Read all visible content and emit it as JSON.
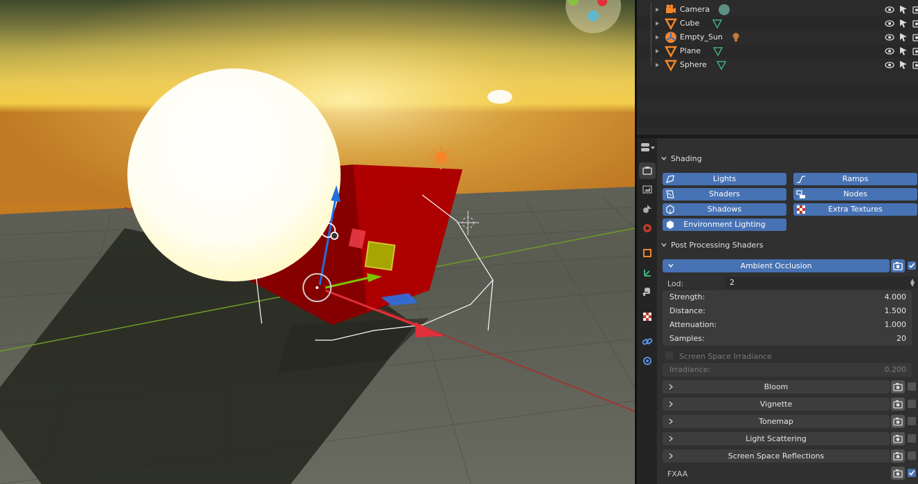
{
  "outliner": {
    "items": [
      {
        "label": "Camera",
        "icon": "camera-object-icon",
        "data_icon": "camera-data-icon"
      },
      {
        "label": "Cube",
        "icon": "mesh-object-icon",
        "data_icon": "mesh-data-icon"
      },
      {
        "label": "Empty_Sun",
        "icon": "empty-object-icon",
        "data_icon": "light-data-icon"
      },
      {
        "label": "Plane",
        "icon": "mesh-object-icon",
        "data_icon": "mesh-data-icon"
      },
      {
        "label": "Sphere",
        "icon": "mesh-object-icon",
        "data_icon": "mesh-data-icon"
      }
    ]
  },
  "properties": {
    "shading": {
      "title": "Shading",
      "buttons": [
        {
          "label": "Lights",
          "icon": "light-icon"
        },
        {
          "label": "Ramps",
          "icon": "ramp-icon"
        },
        {
          "label": "Shaders",
          "icon": "shader-icon"
        },
        {
          "label": "Nodes",
          "icon": "nodes-icon"
        },
        {
          "label": "Shadows",
          "icon": "cube-icon"
        },
        {
          "label": "Extra Textures",
          "icon": "texture-icon"
        },
        {
          "label": "Environment Lighting",
          "icon": "world-cube-icon"
        }
      ]
    },
    "post": {
      "title": "Post Processing Shaders",
      "ao": {
        "title": "Ambient Occlusion",
        "enabled": true,
        "lod_label": "Lod:",
        "lod_value": "2",
        "fields": [
          {
            "label": "Strength:",
            "value": "4.000"
          },
          {
            "label": "Distance:",
            "value": "1.500"
          },
          {
            "label": "Attenuation:",
            "value": "1.000"
          },
          {
            "label": "Samples:",
            "value": "20"
          }
        ]
      },
      "ssi_label": "Screen Space Irradiance",
      "irradiance": {
        "label": "Irradiance:",
        "value": "0.200"
      },
      "subpanels": [
        {
          "label": "Bloom"
        },
        {
          "label": "Vignette"
        },
        {
          "label": "Tonemap"
        },
        {
          "label": "Light Scattering"
        },
        {
          "label": "Screen Space Reflections"
        }
      ],
      "fxaa": {
        "label": "FXAA",
        "enabled": true
      }
    }
  },
  "colors": {
    "accent": "#4772b3",
    "object_orange": "#f5862b",
    "mesh_green": "#3fb07a"
  }
}
